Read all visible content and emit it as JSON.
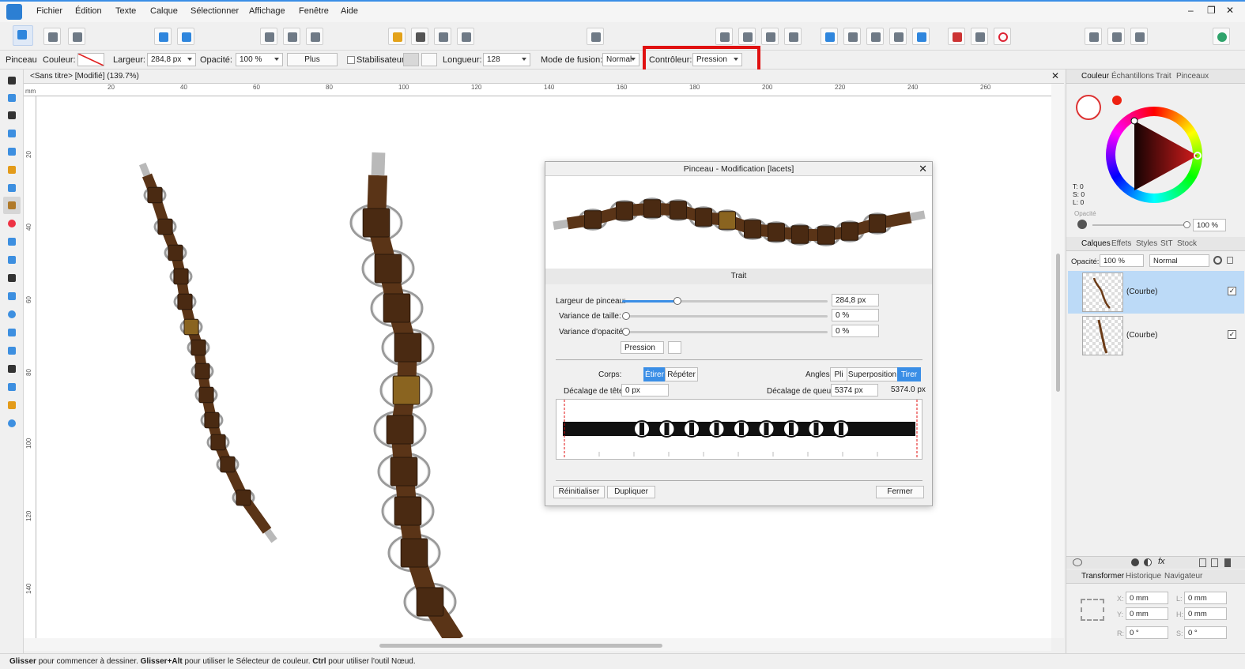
{
  "menu": [
    "Fichier",
    "Édition",
    "Texte",
    "Calque",
    "Sélectionner",
    "Affichage",
    "Fenêtre",
    "Aide"
  ],
  "context": {
    "tool_label": "Pinceau",
    "color_label": "Couleur:",
    "width_label": "Largeur:",
    "width_value": "284,8 px",
    "opacity_label": "Opacité:",
    "opacity_value": "100 %",
    "more_button": "Plus",
    "stabilizer_label": "Stabilisateur",
    "length_label": "Longueur:",
    "length_value": "128",
    "blend_label": "Mode de fusion:",
    "blend_value": "Normal",
    "controller_label": "Contrôleur:",
    "controller_value": "Pression"
  },
  "document": {
    "tab_title": "<Sans titre> [Modifié] (139.7%)",
    "ruler_unit": "mm",
    "hruler_ticks": [
      "20",
      "40",
      "60",
      "80",
      "100",
      "120",
      "140",
      "160",
      "180",
      "200",
      "220",
      "240",
      "260"
    ],
    "vruler_ticks": [
      "20",
      "40",
      "60",
      "80",
      "100",
      "120",
      "140"
    ]
  },
  "dialog": {
    "title": "Pinceau - Modification [lacets]",
    "section": "Trait",
    "brush_width_label": "Largeur de pinceau:",
    "brush_width_value": "284,8 px",
    "brush_width_fraction": 0.27,
    "size_variance_label": "Variance de taille:",
    "size_variance_value": "0 %",
    "opacity_variance_label": "Variance d'opacité:",
    "opacity_variance_value": "0 %",
    "controller_value": "Pression",
    "body_label": "Corps:",
    "body_stretch": "Étirer",
    "body_repeat": "Répéter",
    "angles_label": "Angles:",
    "angle_fold": "Pli",
    "angle_overlap": "Superposition",
    "angle_pull": "Tirer",
    "head_offset_label": "Décalage de tête:",
    "head_offset_value": "0 px",
    "tail_offset_label": "Décalage de queue:",
    "tail_offset_value": "5374 px",
    "tail_total": "5374.0 px",
    "reset_button": "Réinitialiser",
    "duplicate_button": "Dupliquer",
    "close_button": "Fermer"
  },
  "color_panel": {
    "tabs": [
      "Couleur",
      "Échantillons",
      "Trait",
      "Pinceaux"
    ],
    "t": "T: 0",
    "s": "S: 0",
    "l": "L: 0",
    "opacity_label": "Opacité",
    "opacity_value": "100 %"
  },
  "layers_panel": {
    "tabs": [
      "Calques",
      "Effets",
      "Styles",
      "StT",
      "Stock"
    ],
    "opacity_label": "Opacité:",
    "opacity_value": "100 %",
    "blend_value": "Normal",
    "layers": [
      {
        "name": "(Courbe)",
        "checked": "✓"
      },
      {
        "name": "(Courbe)",
        "checked": "✓"
      }
    ]
  },
  "transform_panel": {
    "tabs": [
      "Transformer",
      "Historique",
      "Navigateur"
    ],
    "x_label": "X:",
    "x_value": "0 mm",
    "y_label": "Y:",
    "y_value": "0 mm",
    "w_label": "L:",
    "w_value": "0 mm",
    "h_label": "H:",
    "h_value": "0 mm",
    "r_label": "R:",
    "r_value": "0 °",
    "s_label": "S:",
    "s_value": "0 °"
  },
  "status": {
    "key1": "Glisser",
    "text1": " pour commencer à dessiner. ",
    "key2": "Glisser+Alt",
    "text2": " pour utiliser le Sélecteur de couleur. ",
    "key3": "Ctrl",
    "text3": " pour utiliser l'outil Nœud."
  },
  "colors": {
    "accent": "#3a8ee6",
    "highlight": "#e01010",
    "lace_brown": "#5a3417",
    "lace_gold": "#8a6420",
    "ring_grey": "#9a9a9a"
  }
}
